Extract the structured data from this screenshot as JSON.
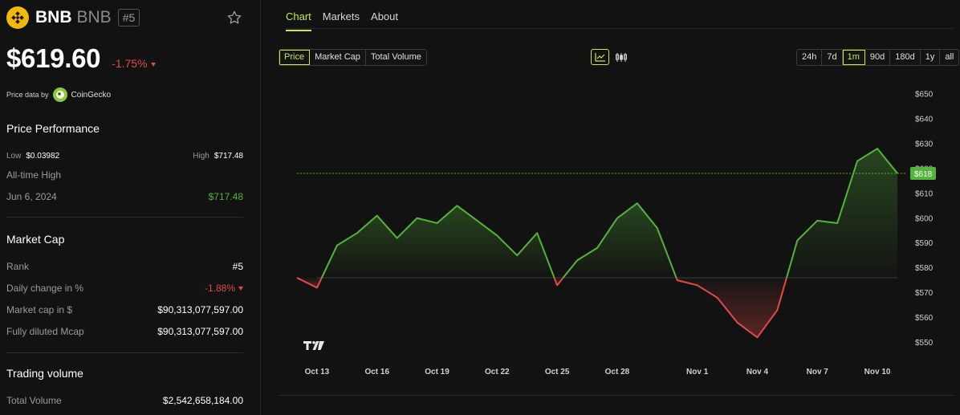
{
  "coin": {
    "name": "BNB",
    "symbol": "BNB",
    "rank": "#5",
    "price": "$619.60",
    "change_24h": "-1.75%"
  },
  "price_data": {
    "label": "Price data by",
    "provider": "CoinGecko"
  },
  "price_performance": {
    "title": "Price Performance",
    "low_label": "Low",
    "low_value": "$0.03982",
    "high_label": "High",
    "high_value": "$717.48",
    "ath_label": "All-time High",
    "ath_date": "Jun 6, 2024",
    "ath_value": "$717.48"
  },
  "market_cap": {
    "title": "Market Cap",
    "rank_label": "Rank",
    "rank_value": "#5",
    "daily_change_label": "Daily change in %",
    "daily_change_value": "-1.88%",
    "mcap_label": "Market cap in $",
    "mcap_value": "$90,313,077,597.00",
    "fdv_label": "Fully diluted Mcap",
    "fdv_value": "$90,313,077,597.00"
  },
  "trading_volume": {
    "title": "Trading volume",
    "total_label": "Total Volume",
    "total_value": "$2,542,658,184.00"
  },
  "tabs": [
    "Chart",
    "Markets",
    "About"
  ],
  "active_tab": "Chart",
  "metric_buttons": [
    "Price",
    "Market Cap",
    "Total Volume"
  ],
  "active_metric": "Price",
  "range_buttons": [
    "24h",
    "7d",
    "1m",
    "90d",
    "180d",
    "1y",
    "all"
  ],
  "active_range": "1m",
  "colors": {
    "accent": "#c5e84a",
    "up": "#54b33a",
    "down": "#e24a4a",
    "brand": "#f0b90b"
  },
  "watermark": "TV",
  "chart_data": {
    "type": "line",
    "baseline": 576,
    "current_price_label": "$618",
    "current_price": 618,
    "ylim": [
      545,
      650
    ],
    "yticks": [
      550,
      560,
      570,
      580,
      590,
      600,
      610,
      620,
      630,
      640,
      650
    ],
    "ytick_labels": [
      "$550",
      "$560",
      "$570",
      "$580",
      "$590",
      "$600",
      "$610",
      "$620",
      "$630",
      "$640",
      "$650"
    ],
    "x": [
      "Oct 12",
      "Oct 13",
      "Oct 14",
      "Oct 15",
      "Oct 16",
      "Oct 17",
      "Oct 18",
      "Oct 19",
      "Oct 20",
      "Oct 21",
      "Oct 22",
      "Oct 23",
      "Oct 24",
      "Oct 25",
      "Oct 26",
      "Oct 27",
      "Oct 28",
      "Oct 29",
      "Oct 30",
      "Oct 31",
      "Nov 1",
      "Nov 2",
      "Nov 3",
      "Nov 4",
      "Nov 5",
      "Nov 6",
      "Nov 7",
      "Nov 8",
      "Nov 9",
      "Nov 10",
      "Nov 11"
    ],
    "values": [
      576,
      572,
      589,
      594,
      601,
      592,
      600,
      598,
      605,
      599,
      593,
      585,
      594,
      573,
      583,
      588,
      600,
      606,
      596,
      575,
      573,
      568,
      558,
      552,
      563,
      591,
      599,
      598,
      623,
      628,
      618
    ],
    "xtick_labels": [
      "Oct 13",
      "Oct 16",
      "Oct 19",
      "Oct 22",
      "Oct 25",
      "Oct 28",
      "Nov 1",
      "Nov 4",
      "Nov 7",
      "Nov 10"
    ],
    "xtick_index": [
      1,
      4,
      7,
      10,
      13,
      16,
      20,
      23,
      26,
      29
    ]
  }
}
